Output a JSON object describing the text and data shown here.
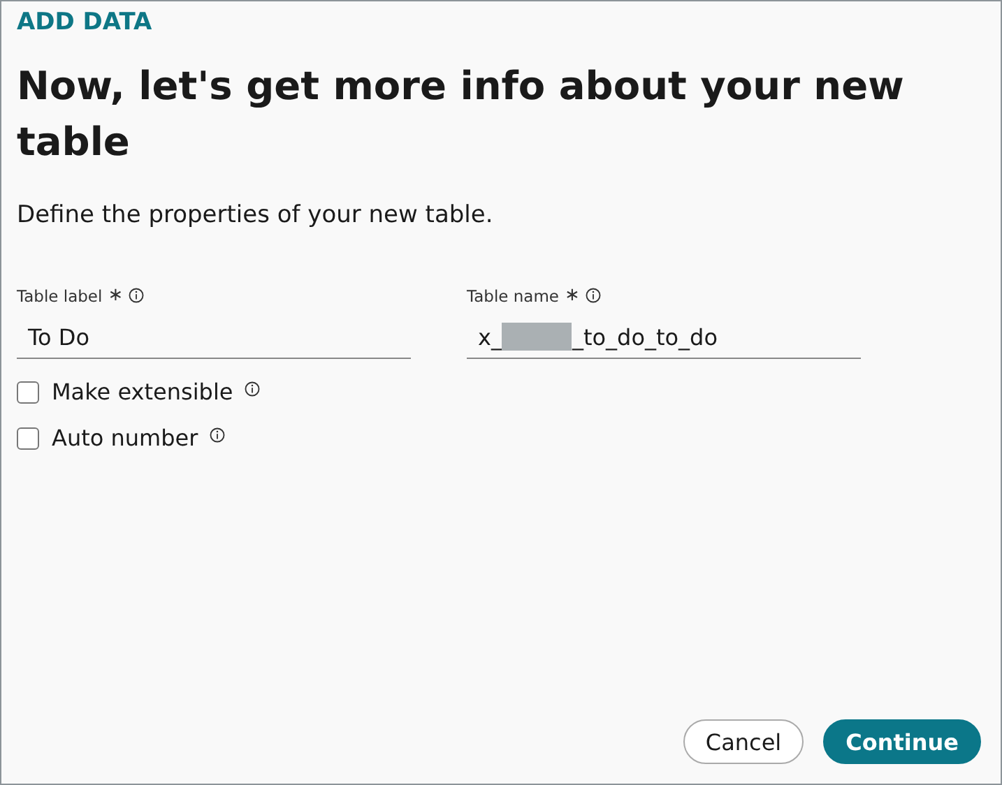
{
  "header": {
    "title": "ADD DATA"
  },
  "heading": "Now, let's get more info about your new table",
  "subtitle": "Define the properties of your new table.",
  "fields": [
    {
      "label": "Table label",
      "required_mark": "∗",
      "value_parts": [
        "To Do"
      ]
    },
    {
      "label": "Table name",
      "required_mark": "∗",
      "value_parts": [
        "x_",
        "_to_do_to_do"
      ]
    }
  ],
  "options": [
    {
      "label": "Make extensible",
      "checked": false
    },
    {
      "label": "Auto number",
      "checked": false
    }
  ],
  "buttons": [
    {
      "label": "Cancel",
      "kind": "secondary"
    },
    {
      "label": "Continue",
      "kind": "primary"
    }
  ]
}
